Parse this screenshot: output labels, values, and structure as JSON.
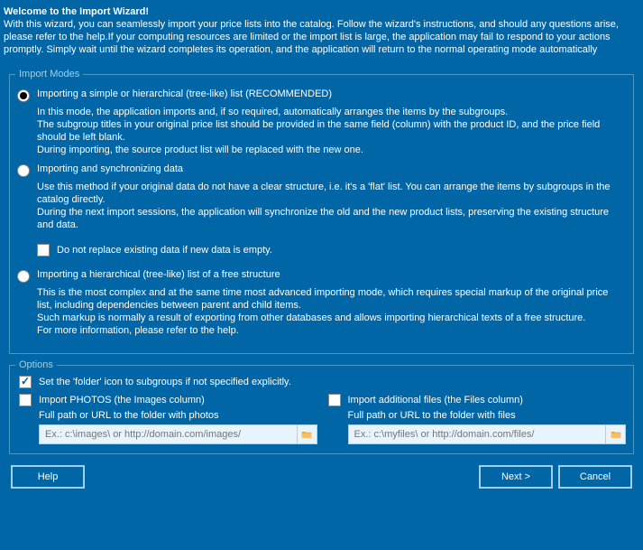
{
  "header": {
    "title": "Welcome to the Import Wizard!",
    "body": "With this wizard, you can seamlessly import your price lists into the catalog. Follow the wizard's instructions, and should any questions arise, please refer to the help.If your computing resources are limited or the import list is large, the application may fail to respond to your actions promptly. Simply wait until the wizard completes its operation, and the application will return to the normal operating mode automatically"
  },
  "modes_group": {
    "legend": "Import Modes",
    "items": [
      {
        "label": "Importing a simple or hierarchical (tree-like) list (RECOMMENDED)",
        "selected": true,
        "desc": "In this mode, the application imports and, if so required, automatically arranges the items by the subgroups.\nThe subgroup titles in your original price list should be provided in the same field (column) with the product ID, and the price field should be left blank.\nDuring importing, the source product list will be replaced with the new one."
      },
      {
        "label": "Importing and synchronizing data",
        "selected": false,
        "desc": "Use this method if your original data do not have a clear structure, i.e. it's a 'flat' list. You can arrange the items by subgroups in the catalog directly.\nDuring the next import sessions, the application will synchronize the old and the new product lists, preserving the existing structure and data.",
        "sub_check": {
          "checked": false,
          "label": "Do not replace existing data if new data is empty."
        }
      },
      {
        "label": "Importing a hierarchical (tree-like) list of a free structure",
        "selected": false,
        "desc": "This is the most complex and at the same time most advanced importing mode, which requires special markup of the original price list, including dependencies between parent and child items.\nSuch markup is normally a result of exporting from other databases and allows importing hierarchical texts of a free structure.\nFor more information, please refer to the help."
      }
    ]
  },
  "options_group": {
    "legend": "Options",
    "folder_icon_check": {
      "checked": true,
      "label": "Set the 'folder' icon to subgroups if not specified explicitly."
    },
    "left": {
      "check": {
        "checked": false,
        "label": "Import PHOTOS (the Images column)"
      },
      "path_label": "Full path or URL to the folder with photos",
      "placeholder": "Ex.: c:\\images\\ or http://domain.com/images/"
    },
    "right": {
      "check": {
        "checked": false,
        "label": "Import additional files (the Files column)"
      },
      "path_label": "Full path or URL to the folder with files",
      "placeholder": "Ex.: c:\\myfiles\\ or http://domain.com/files/"
    }
  },
  "buttons": {
    "help": "Help",
    "next": "Next >",
    "cancel": "Cancel"
  },
  "colors": {
    "bg": "#0066a6",
    "border": "#4a9ac8",
    "input_bg": "#e8f4fb",
    "folder_icon": "#f0a030"
  }
}
